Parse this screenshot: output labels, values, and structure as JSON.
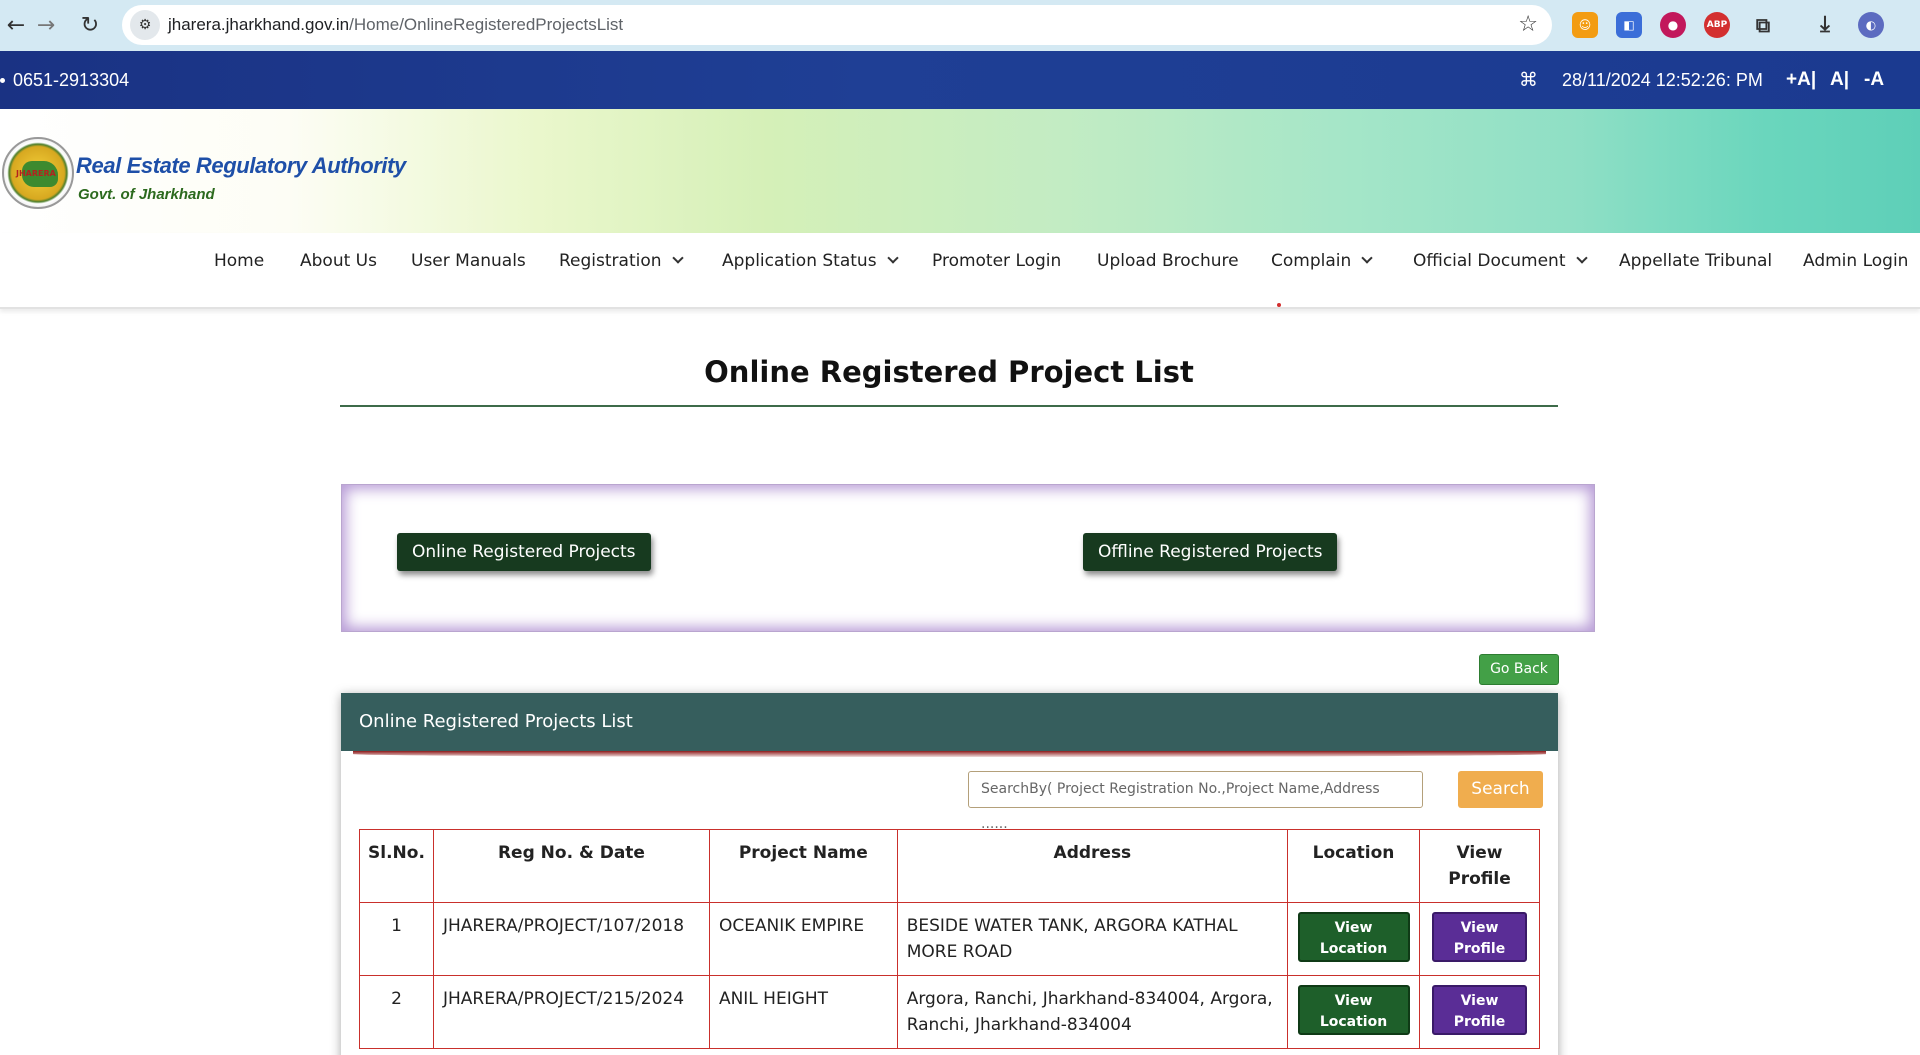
{
  "browser": {
    "url_domain": "jharera.jharkhand.gov.in",
    "url_path": "/Home/OnlineRegisteredProjectsList"
  },
  "topbar": {
    "phone": "0651-2913304",
    "datetime": "28/11/2024 12:52:26: PM",
    "font_increase": "+A|",
    "font_normal": "A|",
    "font_decrease": "-A"
  },
  "header": {
    "title": "Real Estate Regulatory Authority",
    "subtitle": "Govt. of Jharkhand",
    "seal_text": "JHARERA"
  },
  "nav": {
    "items": [
      {
        "label": "Home"
      },
      {
        "label": "About Us"
      },
      {
        "label": "User Manuals"
      },
      {
        "label": "Registration"
      },
      {
        "label": "Application Status"
      },
      {
        "label": "Promoter Login"
      },
      {
        "label": "Upload Brochure"
      },
      {
        "label": "Complain"
      },
      {
        "label": "Official Document"
      },
      {
        "label": "Appellate Tribunal"
      },
      {
        "label": "Admin Login"
      }
    ]
  },
  "page": {
    "title": "Online Registered Project List",
    "online_btn": "Online Registered Projects",
    "offline_btn": "Offline Registered Projects",
    "go_back": "Go Back"
  },
  "panel": {
    "header": "Online Registered Projects List",
    "search_placeholder": "SearchBy( Project Registration No.,Project Name,Address  ......",
    "search_btn": "Search"
  },
  "table": {
    "headers": [
      "Sl.No.",
      "Reg No. & Date",
      "Project Name",
      "Address",
      "Location",
      "View Profile"
    ],
    "rows": [
      {
        "sl": "1",
        "reg": "JHARERA/PROJECT/107/2018",
        "name": "OCEANIK EMPIRE",
        "address": "BESIDE WATER TANK, ARGORA KATHAL MORE ROAD",
        "location_btn": "View Location",
        "profile_btn": "View Profile"
      },
      {
        "sl": "2",
        "reg": "JHARERA/PROJECT/215/2024",
        "name": "ANIL HEIGHT",
        "address": "Argora, Ranchi, Jharkhand-834004, Argora, Ranchi, Jharkhand-834004",
        "location_btn": "View Location",
        "profile_btn": "View Profile"
      }
    ]
  },
  "colors": {
    "topbar": "#1f3f95",
    "panel_header": "#365e5d",
    "selector_button": "#173a1f",
    "location_button": "#1e5f2a",
    "profile_button": "#5a2d96",
    "search_button": "#f0ad4e",
    "go_back": "#43a047",
    "table_border": "#c9302c"
  },
  "icons": {
    "back": "back-arrow-icon",
    "forward": "forward-arrow-icon",
    "reload": "reload-icon",
    "site_info": "site-info-icon",
    "bookmark": "star-icon",
    "sitemap": "sitemap-icon",
    "download": "download-icon",
    "extensions": "puzzle-icon"
  }
}
